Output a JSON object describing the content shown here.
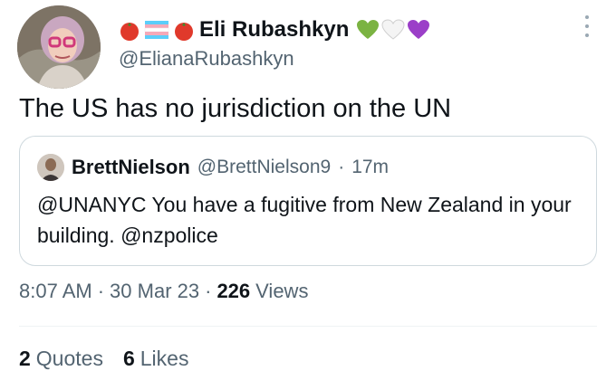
{
  "author": {
    "display_name": "Eli Rubashkyn",
    "handle": "@ElianaRubashkyn",
    "name_prefix_icons": [
      "tomato-icon",
      "transgender-flag-icon",
      "tomato-icon"
    ],
    "name_suffix_icons": [
      "green-heart-icon",
      "white-heart-icon",
      "purple-heart-icon"
    ]
  },
  "tweet": {
    "text": "The US has no jurisdiction on the UN"
  },
  "quoted": {
    "display_name": "BrettNielson",
    "handle": "@BrettNielson9",
    "separator": "·",
    "time": "17m",
    "text": "@UNANYC You have a fugitive from New Zealand in your building. @nzpolice"
  },
  "meta": {
    "time": "8:07 AM",
    "sep1": "·",
    "date": "30 Mar 23",
    "sep2": "·",
    "views_count": "226",
    "views_label": "Views"
  },
  "stats": {
    "quotes_count": "2",
    "quotes_label": "Quotes",
    "likes_count": "6",
    "likes_label": "Likes"
  },
  "colors": {
    "text_primary": "#0f1419",
    "text_secondary": "#536471",
    "border": "#cfd9de"
  }
}
